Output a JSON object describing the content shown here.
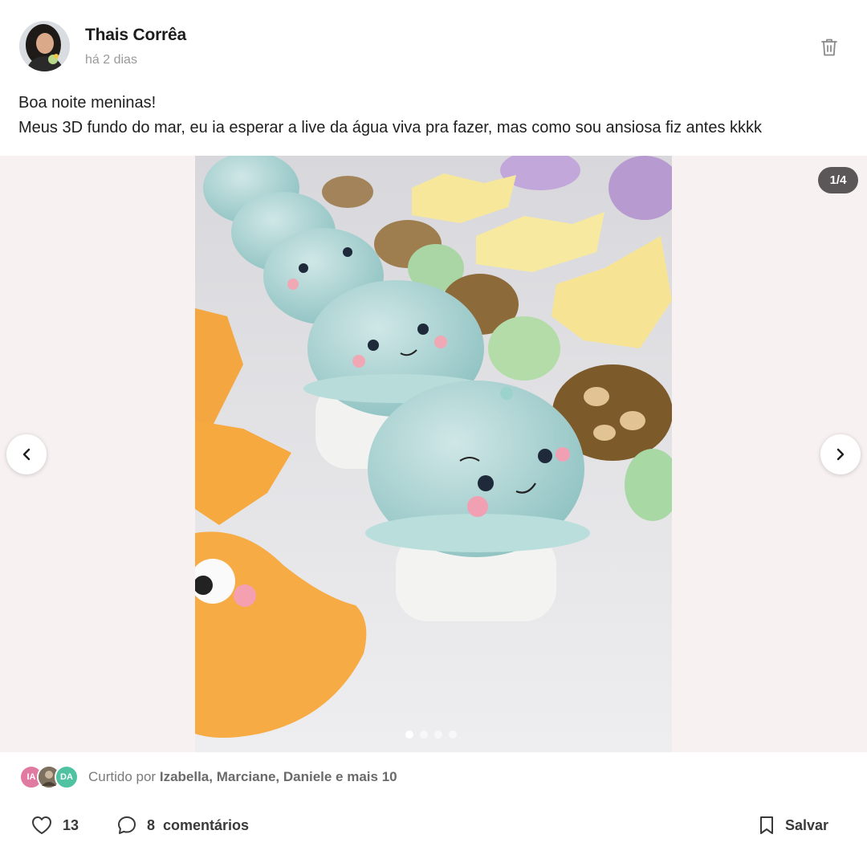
{
  "post": {
    "author": "Thais Corrêa",
    "time": "há 2 dias",
    "caption_line1": "Boa noite meninas!",
    "caption_line2": "Meus 3D fundo do mar, eu ia esperar a live da água viva pra fazer, mas como sou ansiosa fiz antes kkkk"
  },
  "media": {
    "counter": "1/4",
    "dots": 4,
    "active_dot": 0
  },
  "likes": {
    "avatars": [
      {
        "initials": "IA",
        "color": "#e07aa0"
      },
      {
        "initials": "",
        "color": "#8a7a6a"
      },
      {
        "initials": "DA",
        "color": "#4fc3a1"
      }
    ],
    "prefix": "Curtido por",
    "names": "Izabella, Marciane, Daniele e mais 10"
  },
  "actions": {
    "like_count": "13",
    "comment_count": "8",
    "comment_label": "comentários",
    "save_label": "Salvar"
  },
  "icons": {
    "delete": "trash-icon",
    "prev": "chevron-left-icon",
    "next": "chevron-right-icon",
    "like": "heart-icon",
    "comment": "comment-bubble-icon",
    "save": "bookmark-icon"
  },
  "colors": {
    "counter_bg": "#5b5758",
    "media_bg": "#f7f1f2",
    "muted_text": "#9a9a9a"
  }
}
